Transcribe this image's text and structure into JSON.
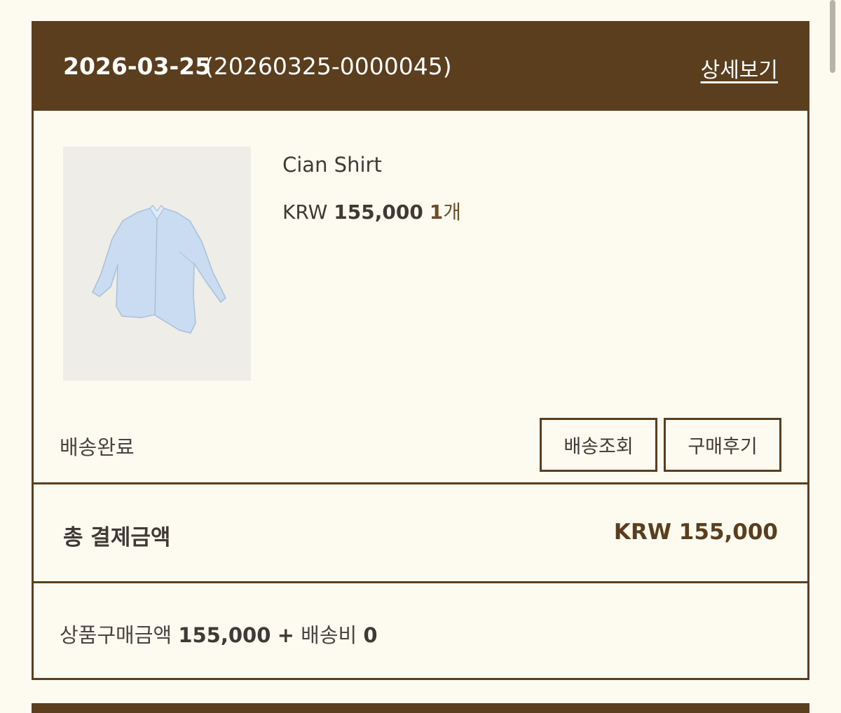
{
  "order": {
    "date": "2026-03-25",
    "order_number": "(20260325-0000045)",
    "detail_link": "상세보기"
  },
  "product": {
    "name": "Cian Shirt",
    "currency": "KRW",
    "price": "155,000",
    "quantity": "1",
    "quantity_unit": "개",
    "image": "light-blue-shirt"
  },
  "status": "배송완료",
  "buttons": {
    "track": "배송조회",
    "review": "구매후기"
  },
  "total": {
    "label": "총 결제금액",
    "value": "KRW 155,000"
  },
  "breakdown": {
    "goods_label": "상품구매금액",
    "goods_value": "155,000",
    "plus": "+",
    "shipping_label": "배송비",
    "shipping_value": "0"
  },
  "colors": {
    "header": "#5a3e1e",
    "background": "#fdfbf0",
    "thumbnail_bg": "#eeede7",
    "shirt": "#c9dcf2"
  }
}
